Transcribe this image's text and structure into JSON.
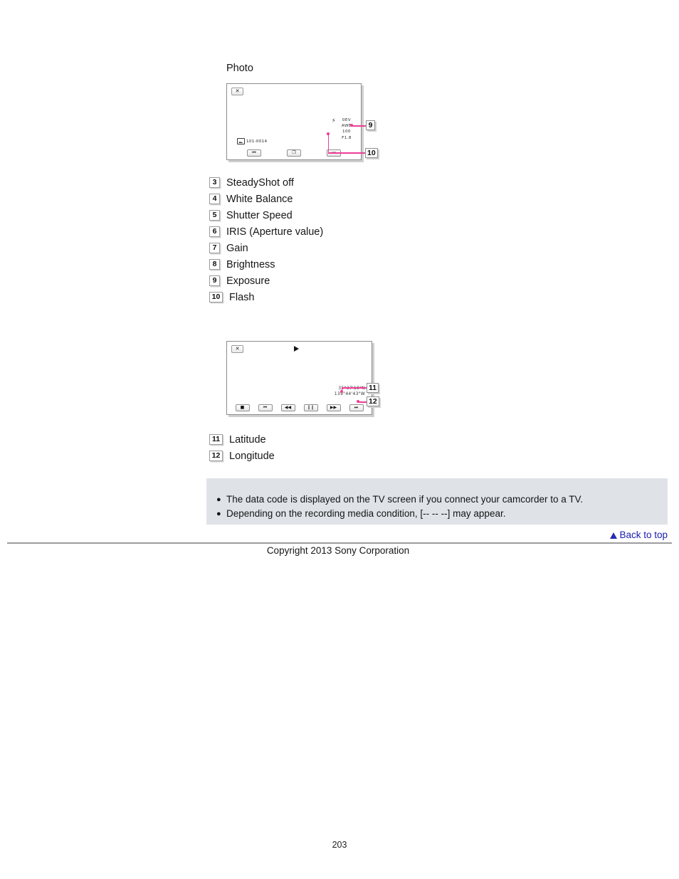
{
  "document": {
    "page_number": "203",
    "copyright": "Copyright 2013 Sony Corporation",
    "back_to_top": "Back to top"
  },
  "photo_section": {
    "heading": "Photo",
    "screen": {
      "close_label": "✕",
      "file_number": "101-0014",
      "flash_symbol": "⚡",
      "data_lines": [
        "0EV",
        "AWB",
        "100",
        "F1.8"
      ],
      "controls": [
        {
          "name": "previous-button",
          "glyph": "⏮"
        },
        {
          "name": "slideshow-button",
          "glyph": "❐"
        },
        {
          "name": "next-button",
          "glyph": "⏭"
        }
      ],
      "callouts": [
        {
          "number": "9",
          "target": "exposure"
        },
        {
          "number": "10",
          "target": "flash"
        }
      ]
    }
  },
  "legend_photo": [
    {
      "number": "3",
      "label": "SteadyShot off"
    },
    {
      "number": "4",
      "label": "White Balance"
    },
    {
      "number": "5",
      "label": "Shutter Speed"
    },
    {
      "number": "6",
      "label": "IRIS (Aperture value)"
    },
    {
      "number": "7",
      "label": "Gain"
    },
    {
      "number": "8",
      "label": "Brightness"
    },
    {
      "number": "9",
      "label": "Exposure"
    },
    {
      "number": "10",
      "label": "Flash"
    }
  ],
  "movie_section": {
    "screen": {
      "close_label": "✕",
      "latitude": "35°37'19\"N",
      "longitude": "139°44'43\"W",
      "controls": [
        {
          "name": "stop-button",
          "glyph": "■"
        },
        {
          "name": "previous-button",
          "glyph": "⏮"
        },
        {
          "name": "rewind-button",
          "glyph": "◀◀"
        },
        {
          "name": "pause-button",
          "glyph": "❙❙"
        },
        {
          "name": "fast-forward-button",
          "glyph": "▶▶"
        },
        {
          "name": "next-button",
          "glyph": "⏭"
        }
      ],
      "callouts": [
        {
          "number": "11",
          "target": "latitude"
        },
        {
          "number": "12",
          "target": "longitude"
        }
      ]
    }
  },
  "legend_movie": [
    {
      "number": "11",
      "label": "Latitude"
    },
    {
      "number": "12",
      "label": "Longitude"
    }
  ],
  "notes": [
    "The data code is displayed on the TV screen if you connect your camcorder to a TV.",
    "Depending on the recording media condition, [-- -- --] may appear."
  ],
  "colors": {
    "callout_line": "#ee3d96",
    "note_background": "#dfe3e8",
    "link": "#1b1bae"
  }
}
